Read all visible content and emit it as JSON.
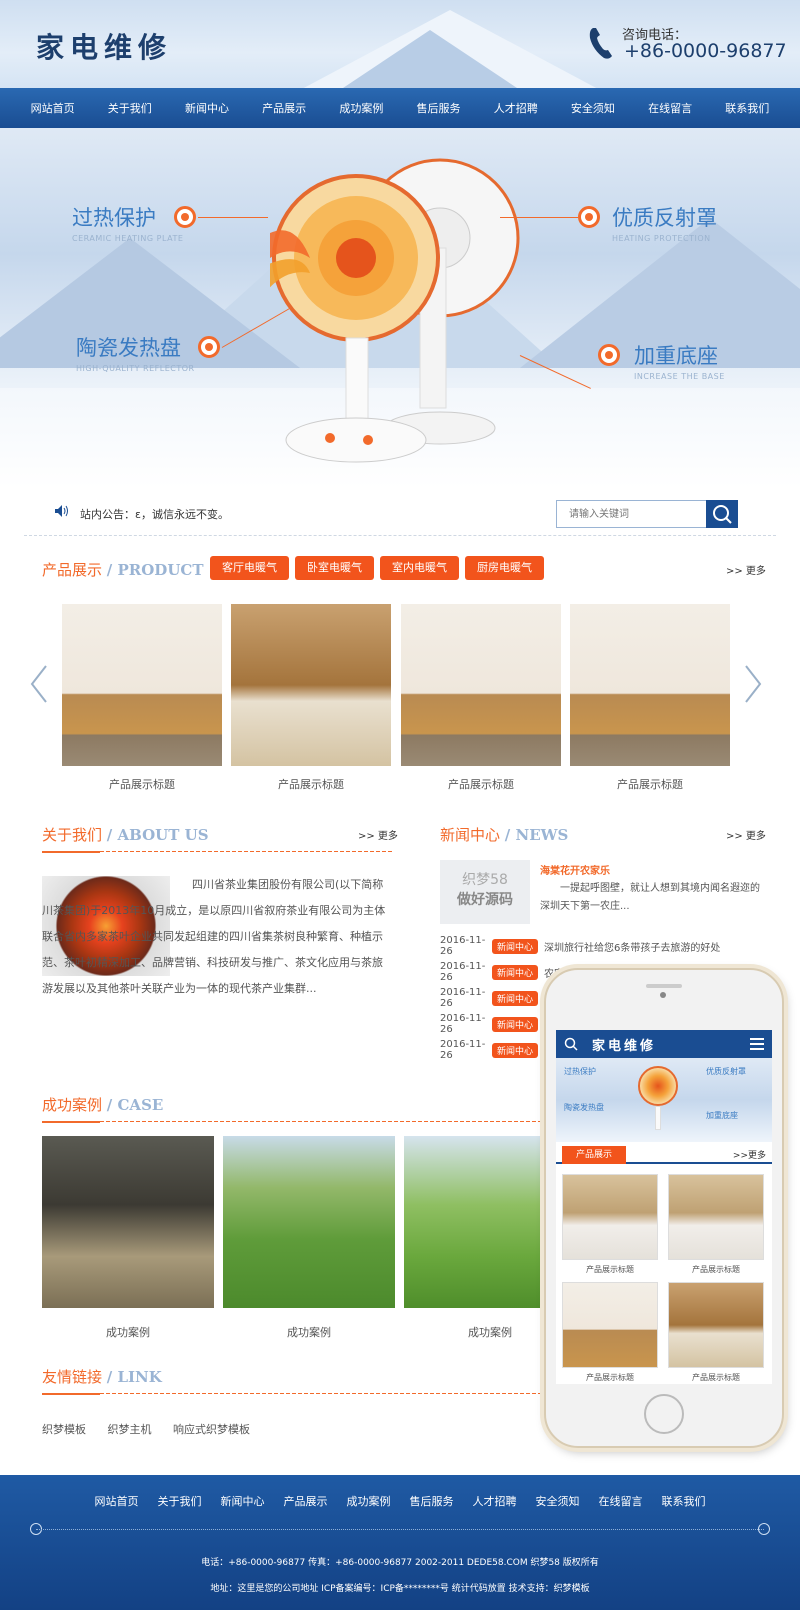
{
  "header": {
    "logo": "家电维修",
    "phone_label": "咨询电话：",
    "phone_number": "+86-0000-96877"
  },
  "nav": [
    "网站首页",
    "关于我们",
    "新闻中心",
    "产品展示",
    "成功案例",
    "售后服务",
    "人才招聘",
    "安全须知",
    "在线留言",
    "联系我们"
  ],
  "banner": {
    "features": [
      {
        "cn": "过热保护",
        "en": "CERAMIC HEATING PLATE"
      },
      {
        "cn": "陶瓷发热盘",
        "en": "HIGH-QUALITY REFLECTOR"
      },
      {
        "cn": "优质反射罩",
        "en": "HEATING PROTECTION"
      },
      {
        "cn": "加重底座",
        "en": "INCREASE THE BASE"
      }
    ]
  },
  "notice": {
    "text": "站内公告：ε，诚信永远不变。",
    "search_placeholder": "请输入关键词"
  },
  "products": {
    "title_cn": "产品展示",
    "title_en": "/ PRODUCT",
    "tags": [
      "客厅电暖气",
      "卧室电暖气",
      "室内电暖气",
      "厨房电暖气"
    ],
    "more": ">> 更多",
    "items": [
      "产品展示标题",
      "产品展示标题",
      "产品展示标题",
      "产品展示标题"
    ]
  },
  "about": {
    "title_cn": "关于我们",
    "title_en": "/ ABOUT US",
    "more": ">> 更多",
    "text": "四川省茶业集团股份有限公司(以下简称川茶集团)于2013年10月成立，是以原四川省叙府茶业有限公司为主体联合省内多家茶叶企业共同发起组建的四川省集茶树良种繁育、种植示范、茶叶初精深加工、品牌营销、科技研发与推广、茶文化应用与茶旅游发展以及其他茶叶关联产业为一体的现代茶产业集群..."
  },
  "news": {
    "title_cn": "新闻中心",
    "title_en": "/ NEWS",
    "more": ">> 更多",
    "thumb_line1": "织梦58",
    "thumb_line2": "做好源码",
    "top_title": "海棠花开农家乐",
    "top_desc": "一提起呼图壁，就让人想到其境内闻名遐迩的深圳天下第一农庄...",
    "badge": "新闻中心",
    "items": [
      {
        "date": "2016-11-26",
        "title": "深圳旅行社给您6条带孩子去旅游的好处"
      },
      {
        "date": "2016-11-26",
        "title": "农家乐交通路线"
      },
      {
        "date": "2016-11-26",
        "title": ""
      },
      {
        "date": "2016-11-26",
        "title": ""
      },
      {
        "date": "2016-11-26",
        "title": ""
      }
    ]
  },
  "cases": {
    "title_cn": "成功案例",
    "title_en": "/ CASE",
    "items": [
      "成功案例",
      "成功案例",
      "成功案例"
    ]
  },
  "links": {
    "title_cn": "友情链接",
    "title_en": "/ LINK",
    "items": [
      "织梦模板",
      "织梦主机",
      "响应式织梦模板"
    ]
  },
  "mobile": {
    "logo": "家电维修",
    "section": "产品展示",
    "more": ">>更多",
    "items": [
      "产品展示标题",
      "产品展示标题",
      "产品展示标题",
      "产品展示标题"
    ],
    "features": [
      "过热保护",
      "优质反射罩",
      "陶瓷发热盘",
      "加重底座"
    ]
  },
  "footer": {
    "nav": [
      "网站首页",
      "关于我们",
      "新闻中心",
      "产品展示",
      "成功案例",
      "售后服务",
      "人才招聘",
      "安全须知",
      "在线留言",
      "联系我们"
    ],
    "line1": "电话：+86-0000-96877   传真：+86-0000-96877   2002-2011 DEDE58.COM 织梦58 版权所有",
    "line2": "地址：这里是您的公司地址   ICP备案编号：ICP备********号   统计代码放置   技术支持：织梦模板"
  },
  "colors": {
    "primary": "#1a4d92",
    "accent": "#f2541c",
    "title_blue": "#9ab4d4"
  }
}
